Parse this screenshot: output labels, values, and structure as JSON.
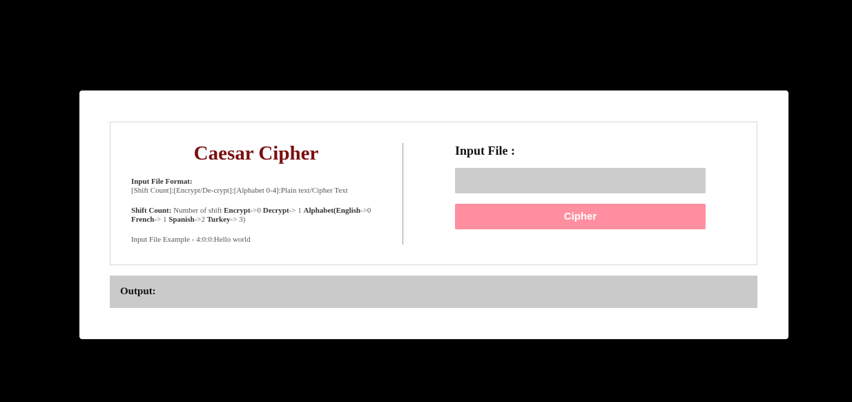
{
  "app": {
    "title": "Caesar Cipher"
  },
  "info": {
    "format_heading": "Input File Format:",
    "format_text": "[Shift Count]:[Encrypt/De-crypt]:[Alphabet 0-4]:Plain text/Cipher Text",
    "shift_heading": "Shift Count:",
    "shift_text_1": " Number of shift ",
    "encrypt_label": "Encrypt",
    "encrypt_value": "->0 ",
    "decrypt_label": "Decrypt",
    "decrypt_value": "-> 1 ",
    "alphabet_label": "Alphabet(English",
    "alphabet_value": "->0",
    "french_label": "French",
    "french_value": "-> 1 ",
    "spanish_label": "Spanish",
    "spanish_value": "->2 ",
    "turkey_label": "Turkey",
    "turkey_value": "-> 3)",
    "example_text": "Input File Example - 4:0:0:Hello world"
  },
  "form": {
    "input_label": "Input File :",
    "cipher_button": "Cipher"
  },
  "output": {
    "label": "Output:"
  },
  "colors": {
    "title": "#7a0f0f",
    "button": "#ff8fa0",
    "input_bg": "#cccccc",
    "output_bg": "#cacaca",
    "page_bg": "#000000"
  }
}
